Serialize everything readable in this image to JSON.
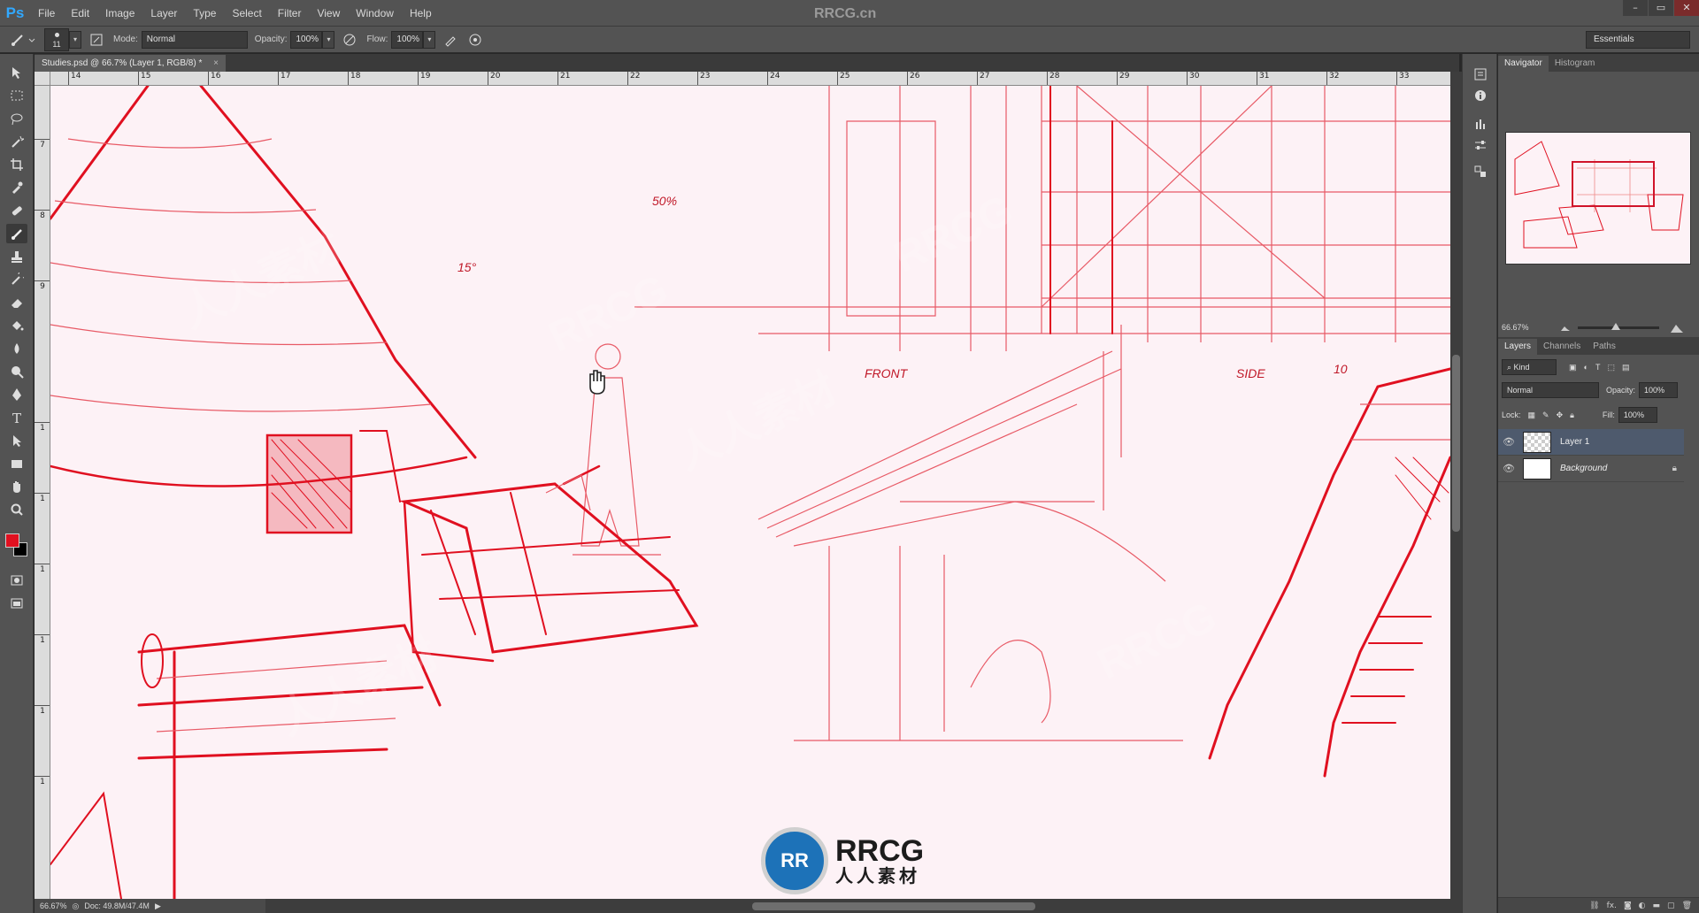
{
  "app": {
    "logo": "Ps",
    "site_mark": "RRCG.cn"
  },
  "menu": [
    "File",
    "Edit",
    "Image",
    "Layer",
    "Type",
    "Select",
    "Filter",
    "View",
    "Window",
    "Help"
  ],
  "window_controls": [
    "–",
    "▭",
    "✕"
  ],
  "options_bar": {
    "brush_size": "11",
    "mode_label": "Mode:",
    "mode_value": "Normal",
    "opacity_label": "Opacity:",
    "opacity_value": "100%",
    "flow_label": "Flow:",
    "flow_value": "100%",
    "workspace": "Essentials"
  },
  "document": {
    "tab_title": "Studies.psd @ 66.7% (Layer 1, RGB/8) *",
    "tab_close": "×",
    "ruler_top": [
      "14",
      "15",
      "16",
      "17",
      "18",
      "19",
      "20",
      "21",
      "22",
      "23",
      "24",
      "25",
      "26",
      "27",
      "28",
      "29",
      "30",
      "31",
      "32",
      "33"
    ],
    "ruler_left": [
      "7",
      "8",
      "9",
      "1",
      "1",
      "1",
      "1",
      "1",
      "1"
    ]
  },
  "canvas_notes": {
    "front": "FRONT",
    "side": "SIDE",
    "pct": "50%",
    "deg": "15°",
    "num": "10"
  },
  "status": {
    "zoom": "66.67%",
    "doc": "Doc: 49.8M/47.4M"
  },
  "navigator": {
    "tabs": [
      "Navigator",
      "Histogram"
    ],
    "zoom": "66.67%"
  },
  "layers_panel": {
    "tabs": [
      "Layers",
      "Channels",
      "Paths"
    ],
    "filter": "Kind",
    "blend_mode": "Normal",
    "opacity_label": "Opacity:",
    "opacity_value": "100%",
    "lock_label": "Lock:",
    "fill_label": "Fill:",
    "fill_value": "100%",
    "layers": [
      {
        "name": "Layer 1",
        "selected": true
      },
      {
        "name": "Background",
        "selected": false
      }
    ],
    "footer_fx": "fx."
  },
  "watermark": {
    "en": "RRCG",
    "cn": "人人素材"
  },
  "colors": {
    "accent_red": "#e01020",
    "canvas_bg": "#fdf2f6",
    "ui_bg": "#535353"
  }
}
